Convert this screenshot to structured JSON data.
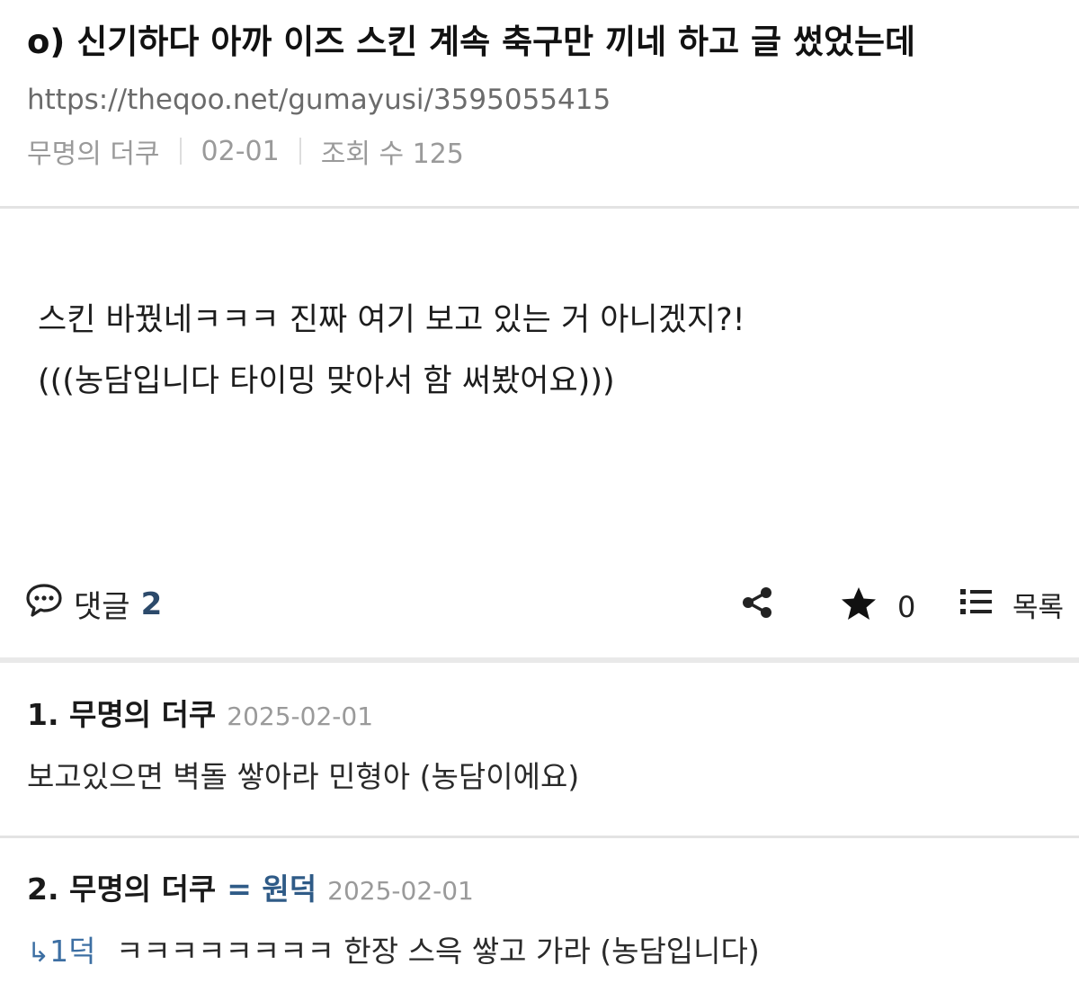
{
  "post": {
    "title": "o) 신기하다 아까 이즈 스킨 계속 축구만 끼네 하고 글 썼었는데",
    "url": "https://theqoo.net/gumayusi/3595055415",
    "author": "무명의 더쿠",
    "date": "02-01",
    "views_label": "조회 수 125",
    "body_lines": [
      "스킨 바꿨네ㅋㅋㅋ 진짜 여기 보고 있는 거 아니겠지?!",
      "(((농담입니다 타이밍 맞아서 함 써봤어요)))"
    ]
  },
  "actions": {
    "comment_label": "댓글",
    "comment_count": "2",
    "star_count": "0",
    "list_label": "목록",
    "icons": [
      "comment-icon",
      "share-icon",
      "star-icon",
      "list-icon"
    ]
  },
  "comments": [
    {
      "author": "1. 무명의 더쿠",
      "date": "2025-02-01",
      "text": "보고있으면 벽돌 쌓아라 민형아 (농담이에요)"
    },
    {
      "author": "2. 무명의 더쿠",
      "tag": "= 원덕",
      "date": "2025-02-01",
      "reply_to": "1덕",
      "text": "ㅋㅋㅋㅋㅋㅋㅋㅋ 한장 스윽 쌓고 가라 (농담입니다)"
    }
  ],
  "colors": {
    "accent": "#2c4a6b",
    "tag": "#2f5b87",
    "reply": "#3d6fa3",
    "meta": "#9a9a9a",
    "divider": "#e3e3e3"
  }
}
